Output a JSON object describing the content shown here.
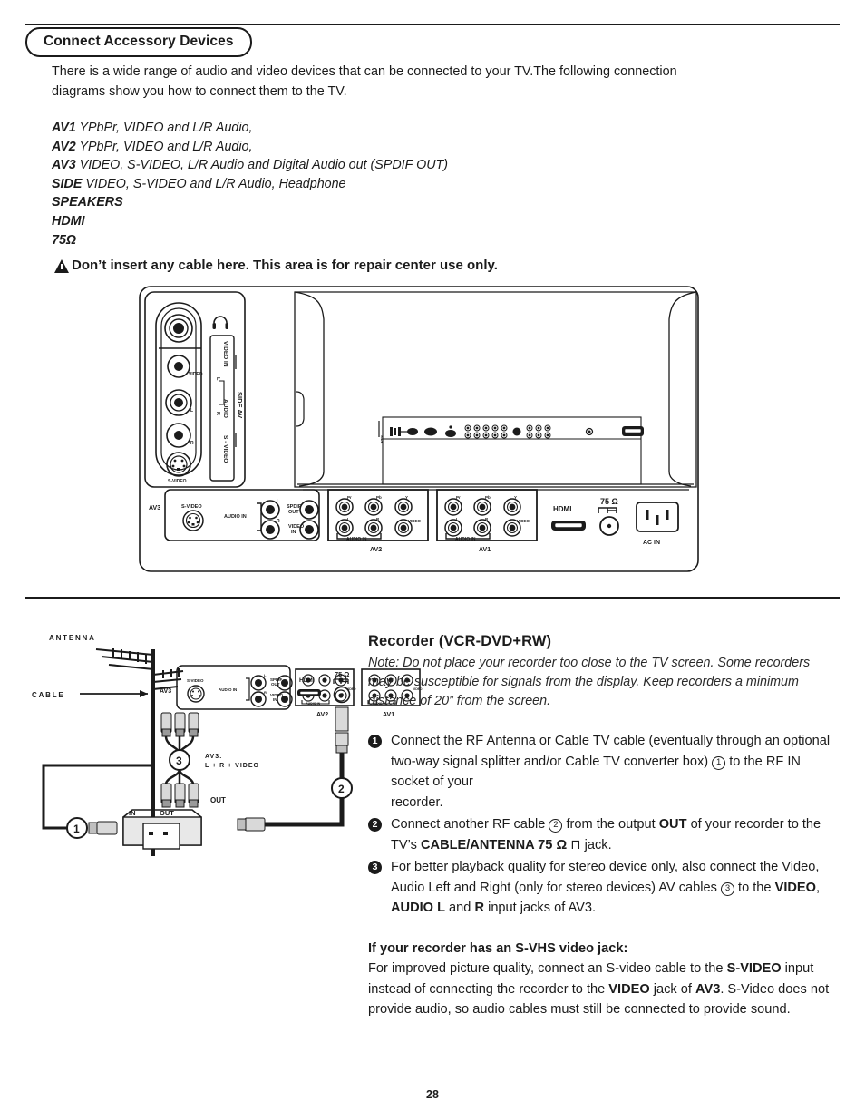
{
  "header": {
    "title": "Connect Accessory Devices"
  },
  "intro": "There is a wide range of audio and video devices that can be connected to your TV.The following connection diagrams show you how to connect them to the TV.",
  "av_list": [
    {
      "name": "AV1",
      "desc": "YPbPr, VIDEO and L/R Audio,"
    },
    {
      "name": "AV2",
      "desc": "YPbPr, VIDEO and L/R Audio,"
    },
    {
      "name": "AV3",
      "desc": "VIDEO, S-VIDEO, L/R Audio and Digital Audio out (SPDIF OUT)"
    },
    {
      "name": "SIDE",
      "desc": "VIDEO, S-VIDEO and L/R Audio, Headphone"
    },
    {
      "name": "SPEAKERS",
      "desc": ""
    },
    {
      "name": "HDMI",
      "desc": ""
    },
    {
      "name": "75Ω",
      "desc": ""
    }
  ],
  "warning": "Don’t insert any cable here. This area is for  repair center use only.",
  "top_diagram": {
    "side_panel": {
      "headphone_icon": "headphone-icon",
      "labels": [
        "VIDEO",
        "L",
        "R",
        "S-VIDEO"
      ],
      "side_labels": [
        "VIDEO IN",
        "AUDIO",
        "L",
        "R",
        "S - VIDEO",
        "SIDE AV"
      ]
    },
    "rear_panel": {
      "av3": {
        "group": "AV3",
        "labels": [
          "S-VIDEO",
          "AUDIO IN",
          "L",
          "R",
          "SPDIF OUT",
          "VIDEO IN"
        ]
      },
      "av2": {
        "group": "AV2",
        "top_labels": [
          "Pr",
          "Pb",
          "Y"
        ],
        "bottom_labels": [
          "L",
          "R",
          "VIDEO"
        ],
        "audio_label": "AUDIO IN"
      },
      "av1": {
        "group": "AV1",
        "top_labels": [
          "Pr",
          "Pb",
          "Y"
        ],
        "bottom_labels": [
          "L",
          "R",
          "VIDEO"
        ],
        "audio_label": "AUDIO IN"
      },
      "hdmi_label": "HDMI",
      "ohm_label": "75 Ω",
      "ac_label": "AC IN"
    }
  },
  "bottom_diagram": {
    "antenna_label": "ANTENNA",
    "cable_label": "CABLE",
    "av3_label": "AV3",
    "av3_panel_labels": [
      "S-VIDEO",
      "AUDIO IN",
      "L",
      "R",
      "SPDIF OUT",
      "VIDEO IN"
    ],
    "av2_label": "AV2",
    "av1_label": "AV1",
    "hdmi_label": "HDMI",
    "ohm_label": "75 Ω",
    "cable_note_line1": "AV3:",
    "cable_note_line2": "L + R + VIDEO",
    "out_label": "OUT",
    "vcr_in_label": "IN",
    "vcr_out_label": "OUT",
    "markers": [
      "1",
      "2",
      "3"
    ]
  },
  "recorder": {
    "title": "Recorder (VCR-DVD+RW)",
    "note": "Note: Do not place your recorder too close to the TV screen. Some recorders may be susceptible for signals from the display. Keep recorders a minimum distance of 20” from the screen.",
    "steps": [
      {
        "num": "1",
        "parts": [
          {
            "t": "Connect the RF Antenna or Cable TV cable (eventually through an optional two-way signal splitter and/or Cable TV converter box) ",
            "s": "n"
          },
          {
            "t": "1",
            "s": "circle"
          },
          {
            "t": " to the RF IN socket of your",
            "s": "n"
          },
          {
            "t": "\nrecorder.",
            "s": "n"
          }
        ]
      },
      {
        "num": "2",
        "parts": [
          {
            "t": "Connect another RF cable ",
            "s": "n"
          },
          {
            "t": "2",
            "s": "circle"
          },
          {
            "t": " from the output ",
            "s": "n"
          },
          {
            "t": "OUT",
            "s": "b"
          },
          {
            "t": " of your recorder to the TV’s ",
            "s": "n"
          },
          {
            "t": "CABLE/ANTENNA 75 Ω",
            "s": "b"
          },
          {
            "t": " ⊓ jack.",
            "s": "n"
          }
        ]
      },
      {
        "num": "3",
        "parts": [
          {
            "t": "For better playback quality for stereo device only, also connect the Video, Audio Left and Right (only for stereo devices) AV cables ",
            "s": "n"
          },
          {
            "t": "3",
            "s": "circle"
          },
          {
            "t": " to the ",
            "s": "n"
          },
          {
            "t": "VIDEO",
            "s": "b"
          },
          {
            "t": ", ",
            "s": "n"
          },
          {
            "t": "AUDIO L",
            "s": "b"
          },
          {
            "t": " and ",
            "s": "n"
          },
          {
            "t": "R",
            "s": "b"
          },
          {
            "t": " input jacks of AV3.",
            "s": "n"
          }
        ]
      }
    ],
    "svhs": {
      "heading_parts": [
        {
          "t": "If your recorder has an ",
          "s": "b"
        },
        {
          "t": "S-VHS",
          "s": "b"
        },
        {
          "t": " video jack:",
          "s": "b"
        }
      ],
      "body_parts": [
        {
          "t": "For improved picture quality, connect an S-video cable to the ",
          "s": "n"
        },
        {
          "t": "S-VIDEO",
          "s": "b"
        },
        {
          "t": " input instead of connecting the recorder to the ",
          "s": "n"
        },
        {
          "t": "VIDEO",
          "s": "b"
        },
        {
          "t": " jack of ",
          "s": "n"
        },
        {
          "t": "AV3",
          "s": "b"
        },
        {
          "t": ". S-Video does not provide audio, so audio cables must still be connected to provide sound.",
          "s": "n"
        }
      ]
    }
  },
  "footer": {
    "page_number": "28"
  },
  "colors": {
    "ink": "#1b1b1b",
    "paper": "#ffffff",
    "grey": "#d9d9d9"
  }
}
